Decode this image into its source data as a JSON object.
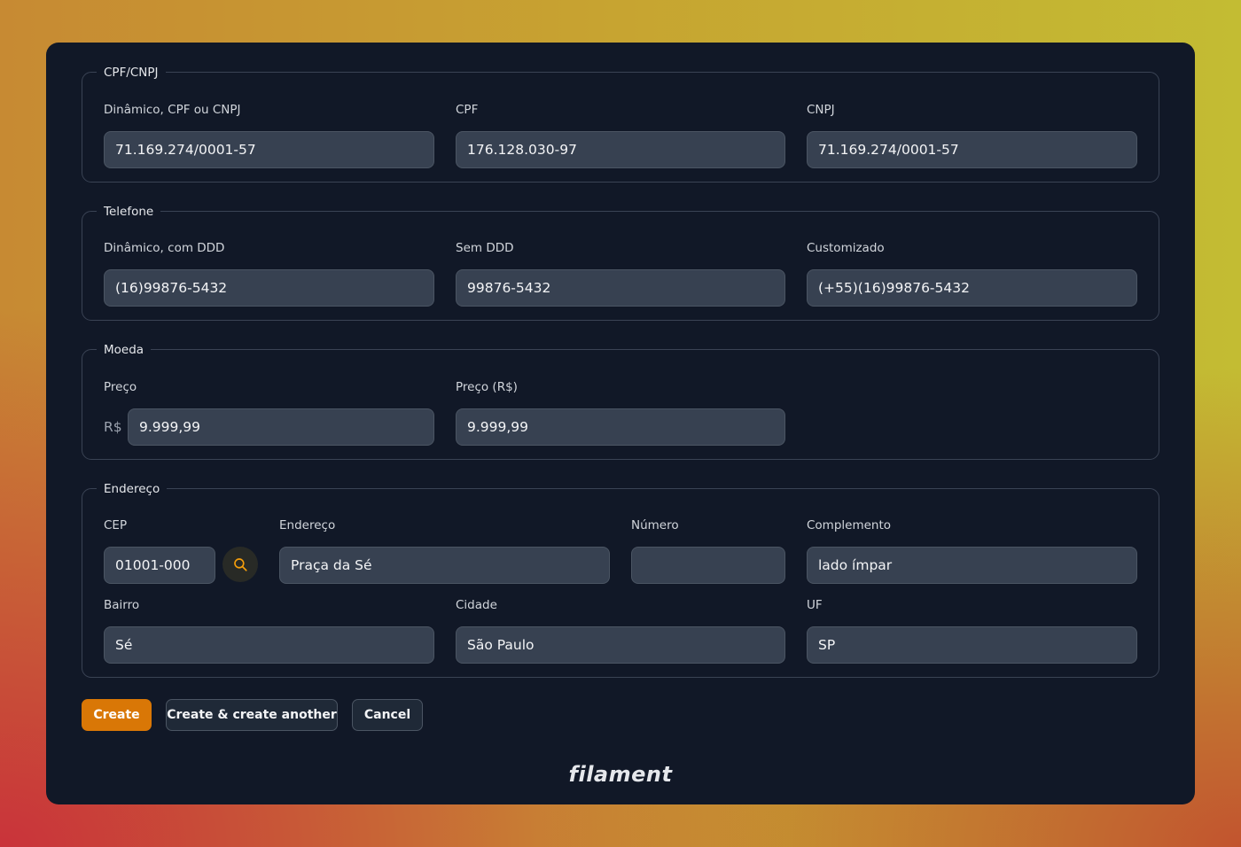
{
  "sections": {
    "cpf_cnpj": {
      "legend": "CPF/CNPJ",
      "fields": [
        {
          "label": "Dinâmico, CPF ou CNPJ",
          "value": "71.169.274/0001-57"
        },
        {
          "label": "CPF",
          "value": "176.128.030-97"
        },
        {
          "label": "CNPJ",
          "value": "71.169.274/0001-57"
        }
      ]
    },
    "telefone": {
      "legend": "Telefone",
      "fields": [
        {
          "label": "Dinâmico, com DDD",
          "value": "(16)99876-5432"
        },
        {
          "label": "Sem DDD",
          "value": "99876-5432"
        },
        {
          "label": "Customizado",
          "value": "(+55)(16)99876-5432"
        }
      ]
    },
    "moeda": {
      "legend": "Moeda",
      "fields": [
        {
          "label": "Preço",
          "prefix": "R$",
          "value": "9.999,99"
        },
        {
          "label": "Preço (R$)",
          "value": "9.999,99"
        }
      ]
    },
    "endereco": {
      "legend": "Endereço",
      "cep": {
        "label": "CEP",
        "value": "01001-000"
      },
      "endereco": {
        "label": "Endereço",
        "value": "Praça da Sé"
      },
      "numero": {
        "label": "Número",
        "value": ""
      },
      "complemento": {
        "label": "Complemento",
        "value": "lado ímpar"
      },
      "bairro": {
        "label": "Bairro",
        "value": "Sé"
      },
      "cidade": {
        "label": "Cidade",
        "value": "São Paulo"
      },
      "uf": {
        "label": "UF",
        "value": "SP"
      }
    }
  },
  "actions": {
    "create": "Create",
    "create_another": "Create & create another",
    "cancel": "Cancel"
  },
  "brand": "filament",
  "icons": {
    "cep_search": "search-icon"
  },
  "colors": {
    "accent": "#d97706",
    "panel": "#111827",
    "input": "#374151"
  }
}
